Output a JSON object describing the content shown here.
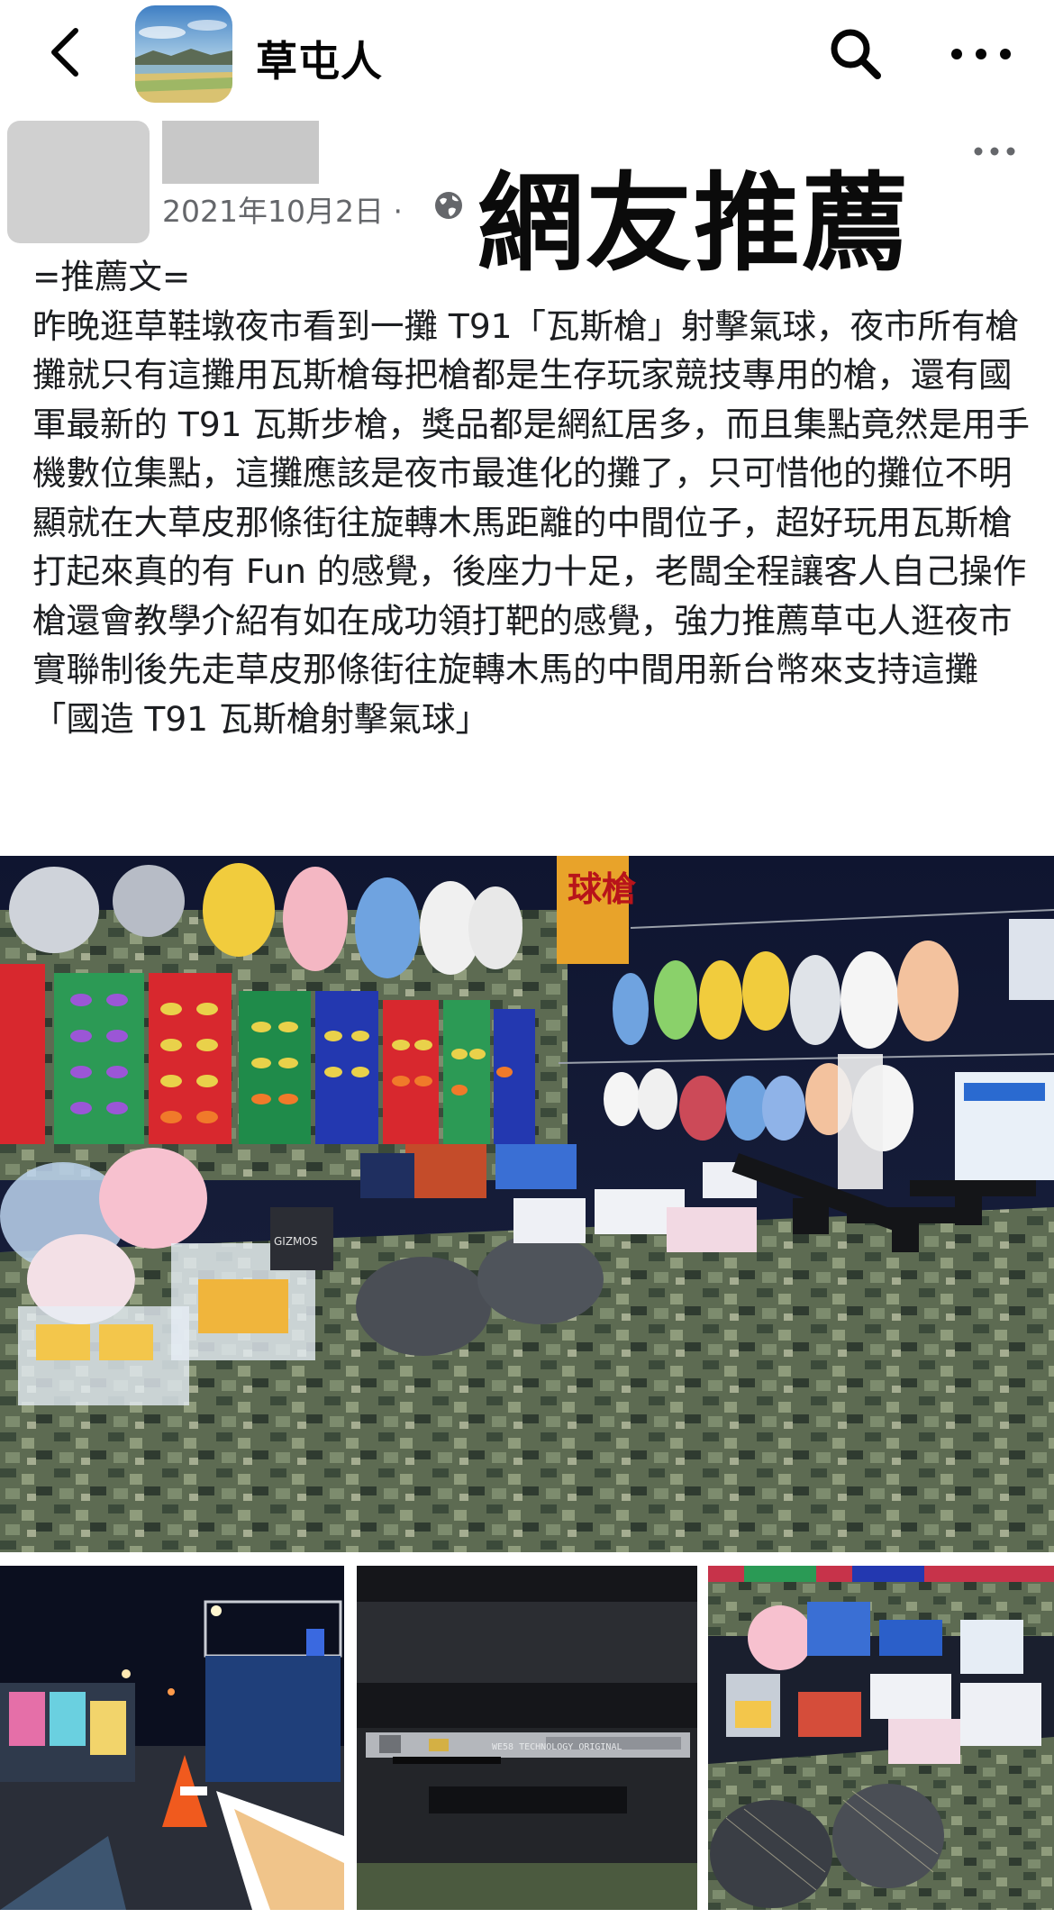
{
  "header": {
    "group_name": "草屯人",
    "icons": {
      "back": "chevron-left-icon",
      "search": "search-icon",
      "more": "more-horizontal-icon"
    }
  },
  "post": {
    "date": "2021年10月2日 ·",
    "privacy_icon": "globe-icon",
    "overlay_title": "網友推薦",
    "body": "=推薦文=\n昨晚逛草鞋墩夜市看到一攤 T91「瓦斯槍」射擊氣球，夜市所有槍攤就只有這攤用瓦斯槍每把槍都是生存玩家競技專用的槍，還有國軍最新的 T91 瓦斯步槍，獎品都是網紅居多，而且集點竟然是用手機數位集點，這攤應該是夜市最進化的攤了，只可惜他的攤位不明顯就在大草皮那條街往旋轉木馬距離的中間位子，超好玩用瓦斯槍打起來真的有 Fun 的感覺，後座力十足，老闆全程讓客人自己操作槍還會教學介紹有如在成功領打靶的感覺，強力推薦草屯人逛夜市實聯制後先走草皮那條街往旋轉木馬的中間用新台幣來支持這攤「國造 T91 瓦斯槍射擊氣球」"
  },
  "photos": {
    "main_sign": "球槍",
    "box_label": "GIZMOS",
    "gun_engraving": "WE58 TECHNOLOGY ORIGINAL"
  },
  "colors": {
    "text": "#1c1e21",
    "meta": "#65676b",
    "camo_dark": "#3b4a3a",
    "camo_light": "#7d8c6e"
  }
}
